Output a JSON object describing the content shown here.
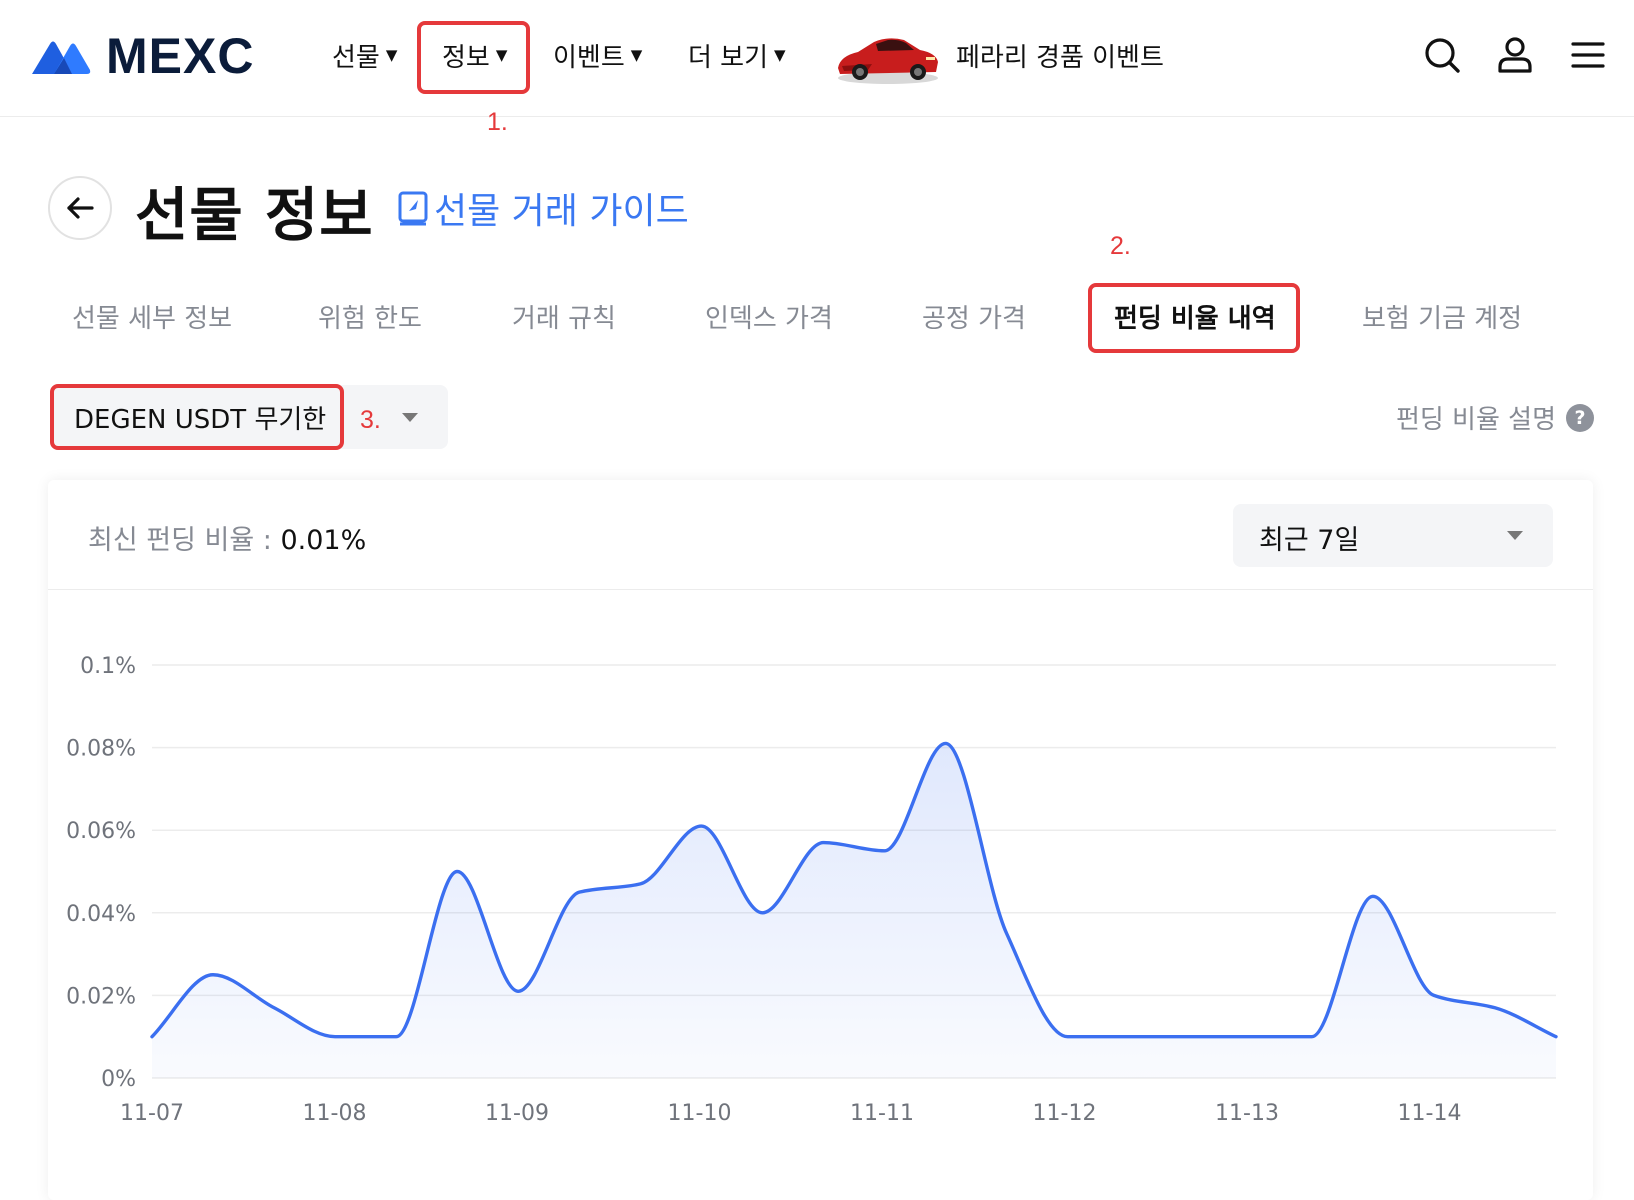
{
  "header": {
    "brand": "MEXC",
    "nav": [
      {
        "label": "선물"
      },
      {
        "label": "정보"
      },
      {
        "label": "이벤트"
      },
      {
        "label": "더 보기"
      }
    ],
    "promo_text": "페라리 경품 이벤트",
    "icons": [
      "search-icon",
      "user-icon",
      "menu-icon"
    ]
  },
  "annotations": [
    "1.",
    "2.",
    "3."
  ],
  "page": {
    "title": "선물 정보",
    "guide_link": "선물 거래 가이드"
  },
  "tabs": [
    {
      "label": "선물 세부 정보",
      "active": false
    },
    {
      "label": "위험 한도",
      "active": false
    },
    {
      "label": "거래 규칙",
      "active": false
    },
    {
      "label": "인덱스 가격",
      "active": false
    },
    {
      "label": "공정 가격",
      "active": false
    },
    {
      "label": "펀딩 비율 내역",
      "active": true
    },
    {
      "label": "보험 기금 계정",
      "active": false
    }
  ],
  "contract_select": {
    "value": "DEGEN USDT 무기한"
  },
  "funding_explain": "펀딩 비율 설명",
  "card": {
    "latest_label": "최신 펀딩 비율 :",
    "latest_value": "0.01%",
    "range_value": "최근 7일"
  },
  "colors": {
    "accent": "#3a78f2",
    "line": "#3b6ff0",
    "annotation": "#e5393b"
  },
  "chart_data": {
    "type": "area",
    "title": "",
    "xlabel": "",
    "ylabel": "",
    "ylim": [
      0,
      0.1
    ],
    "grid": true,
    "legend": "none",
    "y_ticks": [
      "0.1%",
      "0.08%",
      "0.06%",
      "0.04%",
      "0.02%",
      "0%"
    ],
    "y_tick_values": [
      0.1,
      0.08,
      0.06,
      0.04,
      0.02,
      0
    ],
    "x_ticks": [
      "11-07",
      "11-08",
      "11-09",
      "11-10",
      "11-11",
      "11-12",
      "11-13",
      "11-14"
    ],
    "series": [
      {
        "x": [
          "11-07 00:00",
          "11-07 08:00",
          "11-07 16:00",
          "11-08 00:00",
          "11-08 08:00",
          "11-08 16:00",
          "11-09 00:00",
          "11-09 08:00",
          "11-09 16:00",
          "11-10 00:00",
          "11-10 08:00",
          "11-10 16:00",
          "11-11 00:00",
          "11-11 08:00",
          "11-11 16:00",
          "11-12 00:00",
          "11-12 08:00",
          "11-12 16:00",
          "11-13 00:00",
          "11-13 08:00",
          "11-13 16:00",
          "11-14 00:00",
          "11-14 08:00",
          "11-14 16:00"
        ],
        "values": [
          0.01,
          0.025,
          0.017,
          0.01,
          0.01,
          0.05,
          0.021,
          0.045,
          0.047,
          0.061,
          0.04,
          0.057,
          0.055,
          0.081,
          0.035,
          0.01,
          0.01,
          0.01,
          0.01,
          0.01,
          0.044,
          0.02,
          0.017,
          0.01
        ]
      }
    ]
  }
}
